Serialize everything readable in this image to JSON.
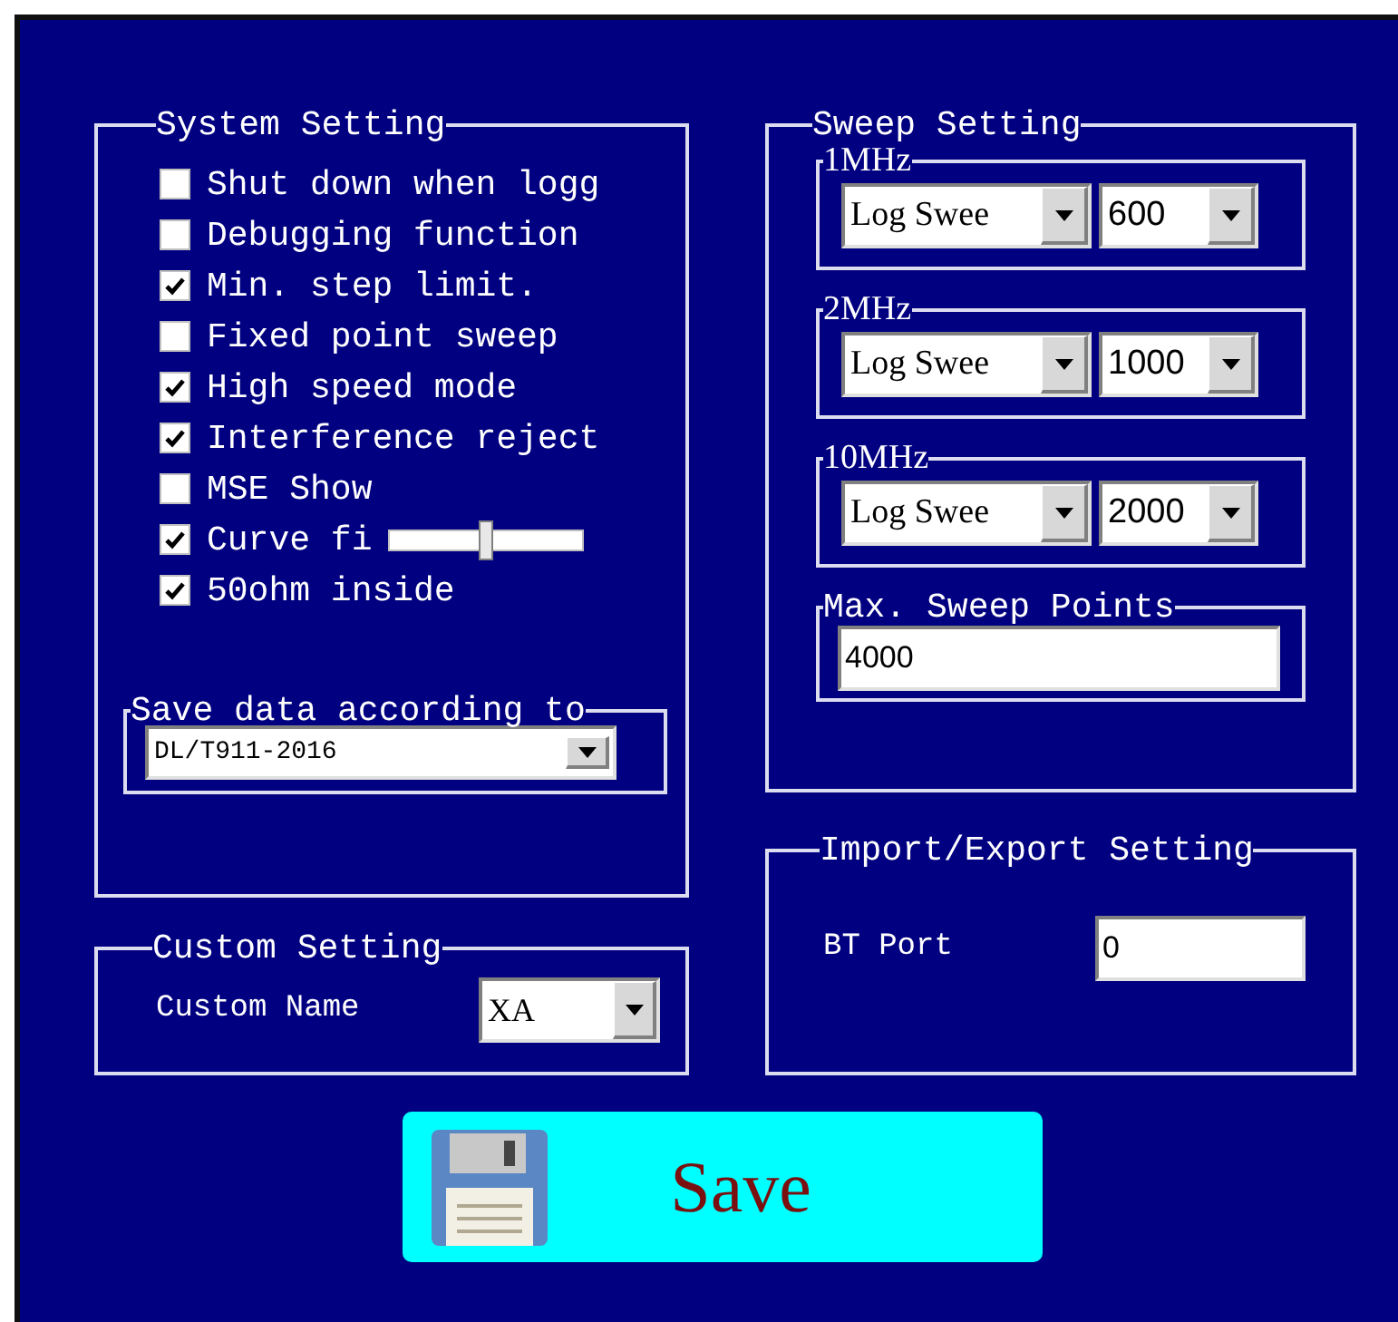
{
  "system_setting": {
    "title": "System Setting",
    "options": [
      {
        "kind": "checkbox",
        "label": "Shut down when logg",
        "checked": false
      },
      {
        "kind": "checkbox",
        "label": "Debugging function",
        "checked": false
      },
      {
        "kind": "checkbox",
        "label": "Min. step limit.",
        "checked": true
      },
      {
        "kind": "checkbox",
        "label": "Fixed point sweep",
        "checked": false
      },
      {
        "kind": "checkbox",
        "label": "High speed mode",
        "checked": true
      },
      {
        "kind": "checkbox",
        "label": "Interference reject",
        "checked": true
      },
      {
        "kind": "checkbox",
        "label": "MSE Show",
        "checked": false
      },
      {
        "kind": "slider",
        "label": "Curve fi",
        "checked": true,
        "level": 0.5
      },
      {
        "kind": "checkbox",
        "label": "50ohm inside",
        "checked": true
      }
    ],
    "save_data": {
      "title": "Save data according to",
      "value": "DL/T911-2016"
    }
  },
  "custom_setting": {
    "title": "Custom Setting",
    "label": "Custom Name",
    "value": "XA"
  },
  "sweep_setting": {
    "title": "Sweep Setting",
    "bands": [
      {
        "title": "1MHz",
        "mode": "Log Swee",
        "points": "600"
      },
      {
        "title": "2MHz",
        "mode": "Log Swee",
        "points": "1000"
      },
      {
        "title": "10MHz",
        "mode": "Log Swee",
        "points": "2000"
      }
    ],
    "max_points": {
      "title": "Max. Sweep Points",
      "value": "4000"
    }
  },
  "import_export": {
    "title": "Import/Export Setting",
    "label": "BT Port",
    "value": "0"
  },
  "save_button": {
    "label": "Save"
  }
}
